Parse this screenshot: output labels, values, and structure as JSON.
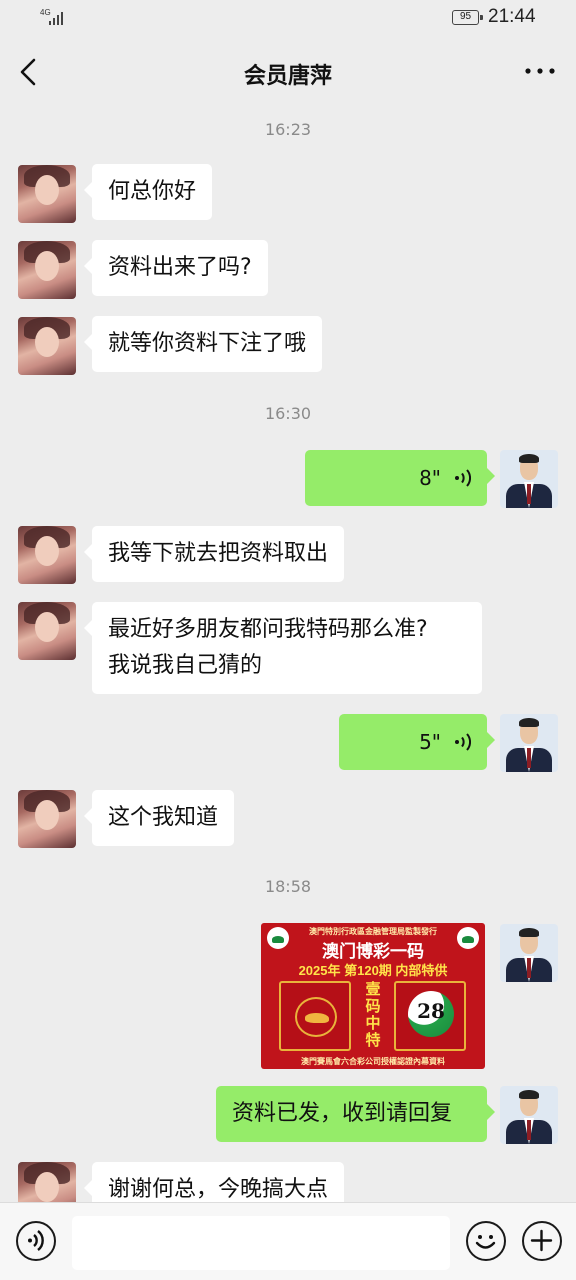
{
  "status_bar": {
    "network_label": "4G",
    "battery": "95",
    "time": "21:44"
  },
  "nav": {
    "title": "会员唐萍",
    "back_icon": "chevron-left-icon",
    "more_icon": "ellipsis-icon"
  },
  "messages": [
    {
      "type": "time",
      "text": "16:23"
    },
    {
      "type": "text",
      "side": "in",
      "text": "何总你好"
    },
    {
      "type": "text",
      "side": "in",
      "text": "资料出来了吗?"
    },
    {
      "type": "text",
      "side": "in",
      "text": "就等你资料下注了哦"
    },
    {
      "type": "time",
      "text": "16:30"
    },
    {
      "type": "voice",
      "side": "out",
      "duration": "8\""
    },
    {
      "type": "text",
      "side": "in",
      "text": "我等下就去把资料取出"
    },
    {
      "type": "text",
      "side": "in",
      "lines": [
        "最近好多朋友都问我特码那么准?",
        "我说我自己猜的"
      ]
    },
    {
      "type": "voice",
      "side": "out",
      "duration": "5\""
    },
    {
      "type": "text",
      "side": "in",
      "text": "这个我知道"
    },
    {
      "type": "time",
      "text": "18:58"
    },
    {
      "type": "image",
      "side": "out",
      "image": {
        "top_text": "澳門特別行政區金融管理局監製發行",
        "title": "澳门博彩一码",
        "subtitle": "2025年 第120期 内部特供",
        "middle": [
          "壹",
          "码",
          "中",
          "特"
        ],
        "number": "28",
        "footer": "澳門賽馬會六合彩公司授權認證內幕資料"
      }
    },
    {
      "type": "text",
      "side": "out",
      "text": "资料已发，收到请回复"
    },
    {
      "type": "text",
      "side": "in",
      "text": "谢谢何总，今晚搞大点"
    }
  ],
  "input_bar": {
    "voice_icon": "voice-toggle-icon",
    "input_value": "",
    "emoji_icon": "emoji-icon",
    "plus_icon": "plus-icon"
  },
  "colors": {
    "background": "#ededed",
    "incoming_bubble": "#ffffff",
    "outgoing_bubble": "#95ec69",
    "timestamp": "#8a8a8a"
  }
}
